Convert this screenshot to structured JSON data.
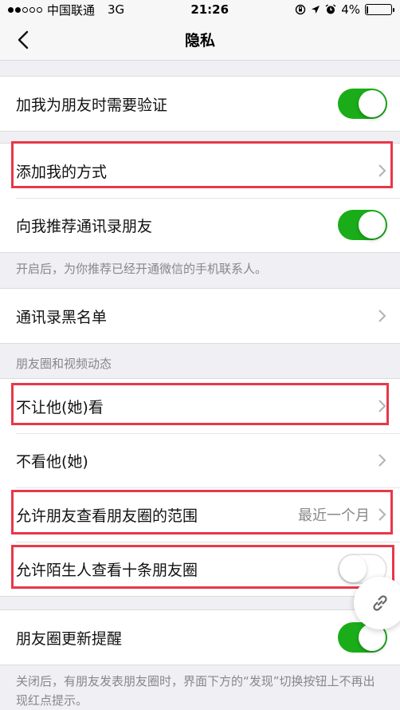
{
  "status_bar": {
    "carrier": "中国联通",
    "network": "3G",
    "time": "21:26",
    "battery": "4%",
    "battery_level": 0.04
  },
  "nav": {
    "title": "隐私"
  },
  "settings": {
    "verify_friend": {
      "label": "加我为朋友时需要验证",
      "enabled": true
    },
    "add_methods": {
      "label": "添加我的方式"
    },
    "recommend_contacts": {
      "label": "向我推荐通讯录朋友",
      "enabled": true,
      "hint": "开启后，为你推荐已经开通微信的手机联系人。"
    },
    "blacklist": {
      "label": "通讯录黑名单"
    }
  },
  "moments": {
    "header": "朋友圈和视频动态",
    "block_view": {
      "label": "不让他(她)看"
    },
    "not_view": {
      "label": "不看他(她)"
    },
    "view_range": {
      "label": "允许朋友查看朋友圈的范围",
      "value": "最近一个月"
    },
    "stranger_view": {
      "label": "允许陌生人查看十条朋友圈",
      "enabled": false
    },
    "update_reminder": {
      "label": "朋友圈更新提醒",
      "enabled": true,
      "hint": "关闭后，有朋友发表朋友圈时，界面下方的“发现”切换按钮上不再出现红点提示。"
    }
  },
  "colors": {
    "highlight": "#e8374a",
    "toggle_on": "#1aad19",
    "background": "#efeff4"
  },
  "icons": {
    "back": "chevron-left-icon",
    "link": "link-icon",
    "alarm": "alarm-icon",
    "location": "location-arrow-icon",
    "rotation_lock": "rotation-lock-icon"
  }
}
